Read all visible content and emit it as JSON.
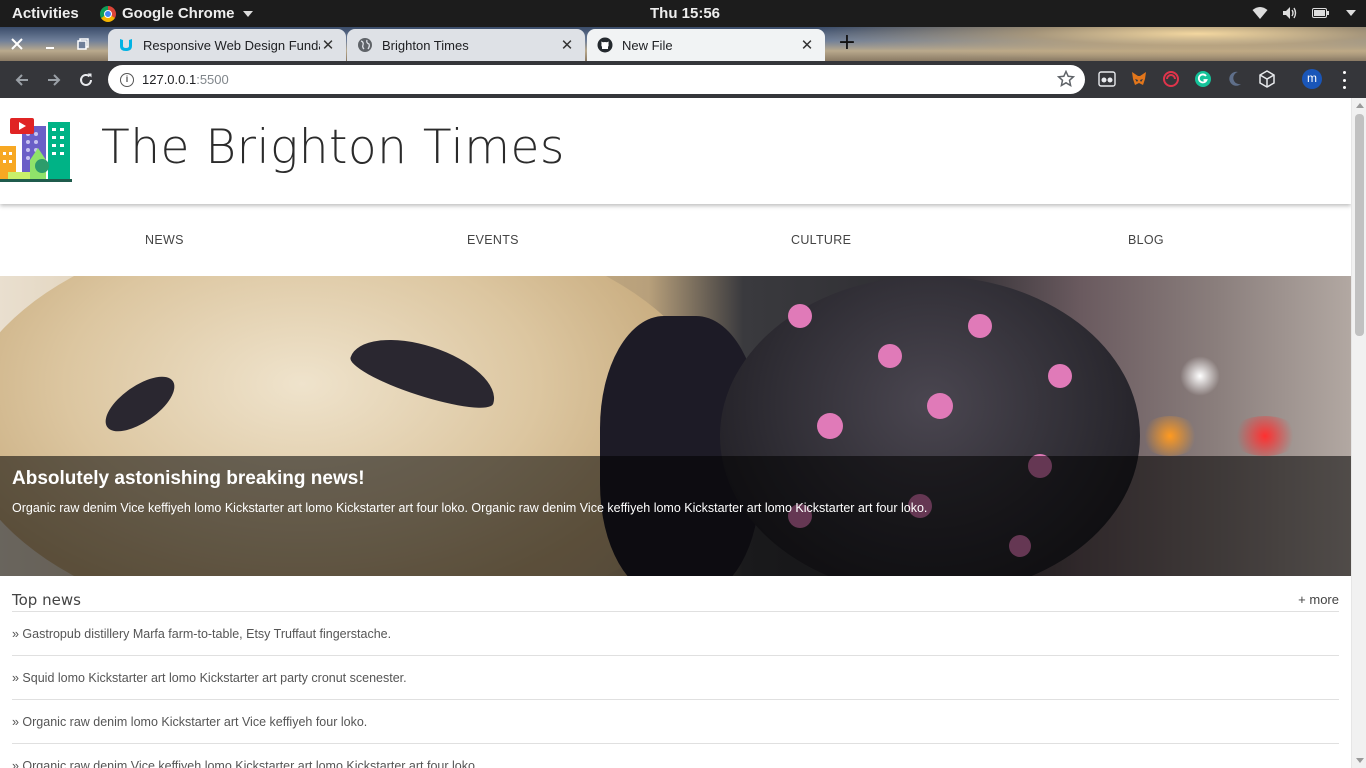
{
  "system": {
    "activities": "Activities",
    "app_name": "Google Chrome",
    "clock": "Thu 15:56"
  },
  "tabs": [
    {
      "title": "Responsive Web Design Fundamentals",
      "favicon": "udacity-icon"
    },
    {
      "title": "Brighton Times",
      "favicon": "globe-icon",
      "active": true
    },
    {
      "title": "New File",
      "favicon": "github-icon"
    }
  ],
  "address_bar": {
    "host": "127.0.0.1",
    "port": ":5500"
  },
  "profile": {
    "initial": "m"
  },
  "site": {
    "title": "The Brighton Times",
    "nav": [
      "NEWS",
      "EVENTS",
      "CULTURE",
      "BLOG"
    ],
    "hero": {
      "headline": "Absolutely astonishing breaking news!",
      "summary": "Organic raw denim Vice keffiyeh lomo Kickstarter art lomo Kickstarter art four loko. Organic raw denim Vice keffiyeh lomo Kickstarter art lomo Kickstarter art four loko."
    },
    "top_news": {
      "label": "Top news",
      "more": "+ more",
      "items": [
        "» Gastropub distillery Marfa farm-to-table, Etsy Truffaut fingerstache.",
        "» Squid lomo Kickstarter art lomo Kickstarter art party cronut scenester.",
        "» Organic raw denim lomo Kickstarter art Vice keffiyeh four loko.",
        "» Organic raw denim Vice keffiyeh lomo Kickstarter art lomo Kickstarter art four loko."
      ]
    }
  },
  "colors": {
    "topbar": "#1c1c1c",
    "toolbar": "#35363a",
    "tab_bg": "#dee1e6",
    "avatar": "#1a56b8"
  }
}
